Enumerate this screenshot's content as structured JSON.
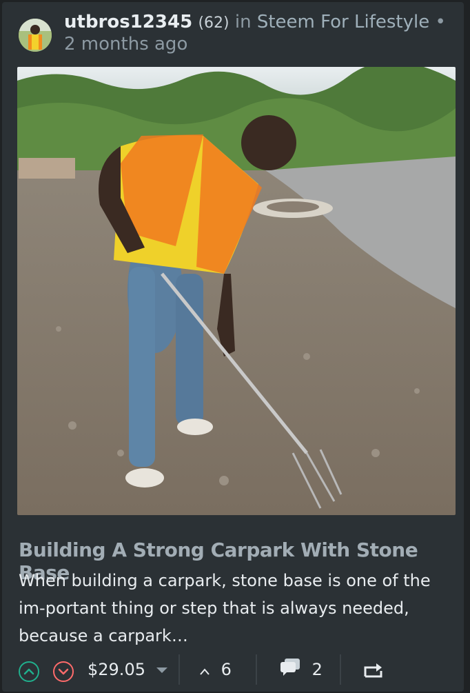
{
  "post": {
    "author": "utbros12345",
    "reputation": "(62)",
    "in_label": "in",
    "community": "Steem For Lifestyle",
    "time_separator": "•",
    "time_ago": "2 months ago",
    "title": "Building A Strong Carpark With Stone Base",
    "excerpt": "When building a carpark, stone base is one of the im-portant thing or step that is always needed, because a carpark…",
    "payout": "$29.05",
    "votes": "6",
    "comments": "2"
  },
  "icons": {
    "upvote": "upvote-icon",
    "downvote": "downvote-icon",
    "payout_dropdown": "caret-down-icon",
    "votes": "chevron-up-icon",
    "comments": "comment-icon",
    "reblog": "reblog-icon"
  },
  "colors": {
    "upvote": "#20b08d",
    "downvote": "#ff6b6b",
    "card_bg": "#2b3135"
  }
}
